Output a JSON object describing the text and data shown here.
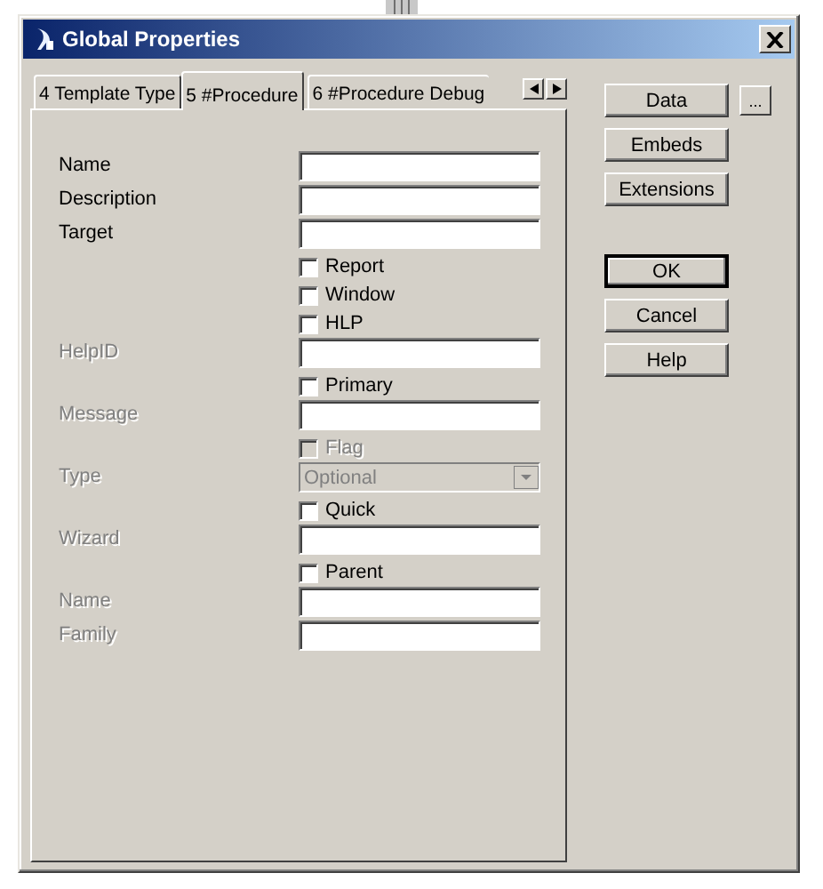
{
  "window": {
    "title": "Global Properties"
  },
  "tabs": [
    {
      "label": "4 Template Type",
      "selected": false
    },
    {
      "label": "5 #Procedure",
      "selected": true
    },
    {
      "label": "6 #Procedure Debug",
      "selected": false
    }
  ],
  "form": [
    {
      "kind": "text",
      "label": "Name",
      "disabled": false
    },
    {
      "kind": "text",
      "label": "Description",
      "disabled": false
    },
    {
      "kind": "text",
      "label": "Target",
      "disabled": false
    },
    {
      "kind": "checkbox",
      "label": "Report",
      "checked": false,
      "disabled": false
    },
    {
      "kind": "checkbox",
      "label": "Window",
      "checked": false,
      "disabled": false
    },
    {
      "kind": "checkbox",
      "label": "HLP",
      "checked": false,
      "disabled": false
    },
    {
      "kind": "text",
      "label": "HelpID",
      "disabled": true
    },
    {
      "kind": "checkbox",
      "label": "Primary",
      "checked": false,
      "disabled": false
    },
    {
      "kind": "text",
      "label": "Message",
      "disabled": true
    },
    {
      "kind": "checkbox",
      "label": "Flag",
      "checked": false,
      "disabled": true
    },
    {
      "kind": "dropdown",
      "label": "Type",
      "value": "Optional",
      "disabled": true
    },
    {
      "kind": "checkbox",
      "label": "Quick",
      "checked": false,
      "disabled": false
    },
    {
      "kind": "text",
      "label": "Wizard",
      "disabled": true
    },
    {
      "kind": "checkbox",
      "label": "Parent",
      "checked": false,
      "disabled": false
    },
    {
      "kind": "text",
      "label": "Name",
      "disabled": true
    },
    {
      "kind": "text",
      "label": "Family",
      "disabled": true
    }
  ],
  "side_buttons": [
    {
      "label": "Data"
    },
    {
      "label": "Embeds"
    },
    {
      "label": "Extensions"
    }
  ],
  "browse_button": {
    "label": "..."
  },
  "dialog_buttons": [
    {
      "label": "OK",
      "default": true
    },
    {
      "label": "Cancel",
      "default": false
    },
    {
      "label": "Help",
      "default": false
    }
  ]
}
